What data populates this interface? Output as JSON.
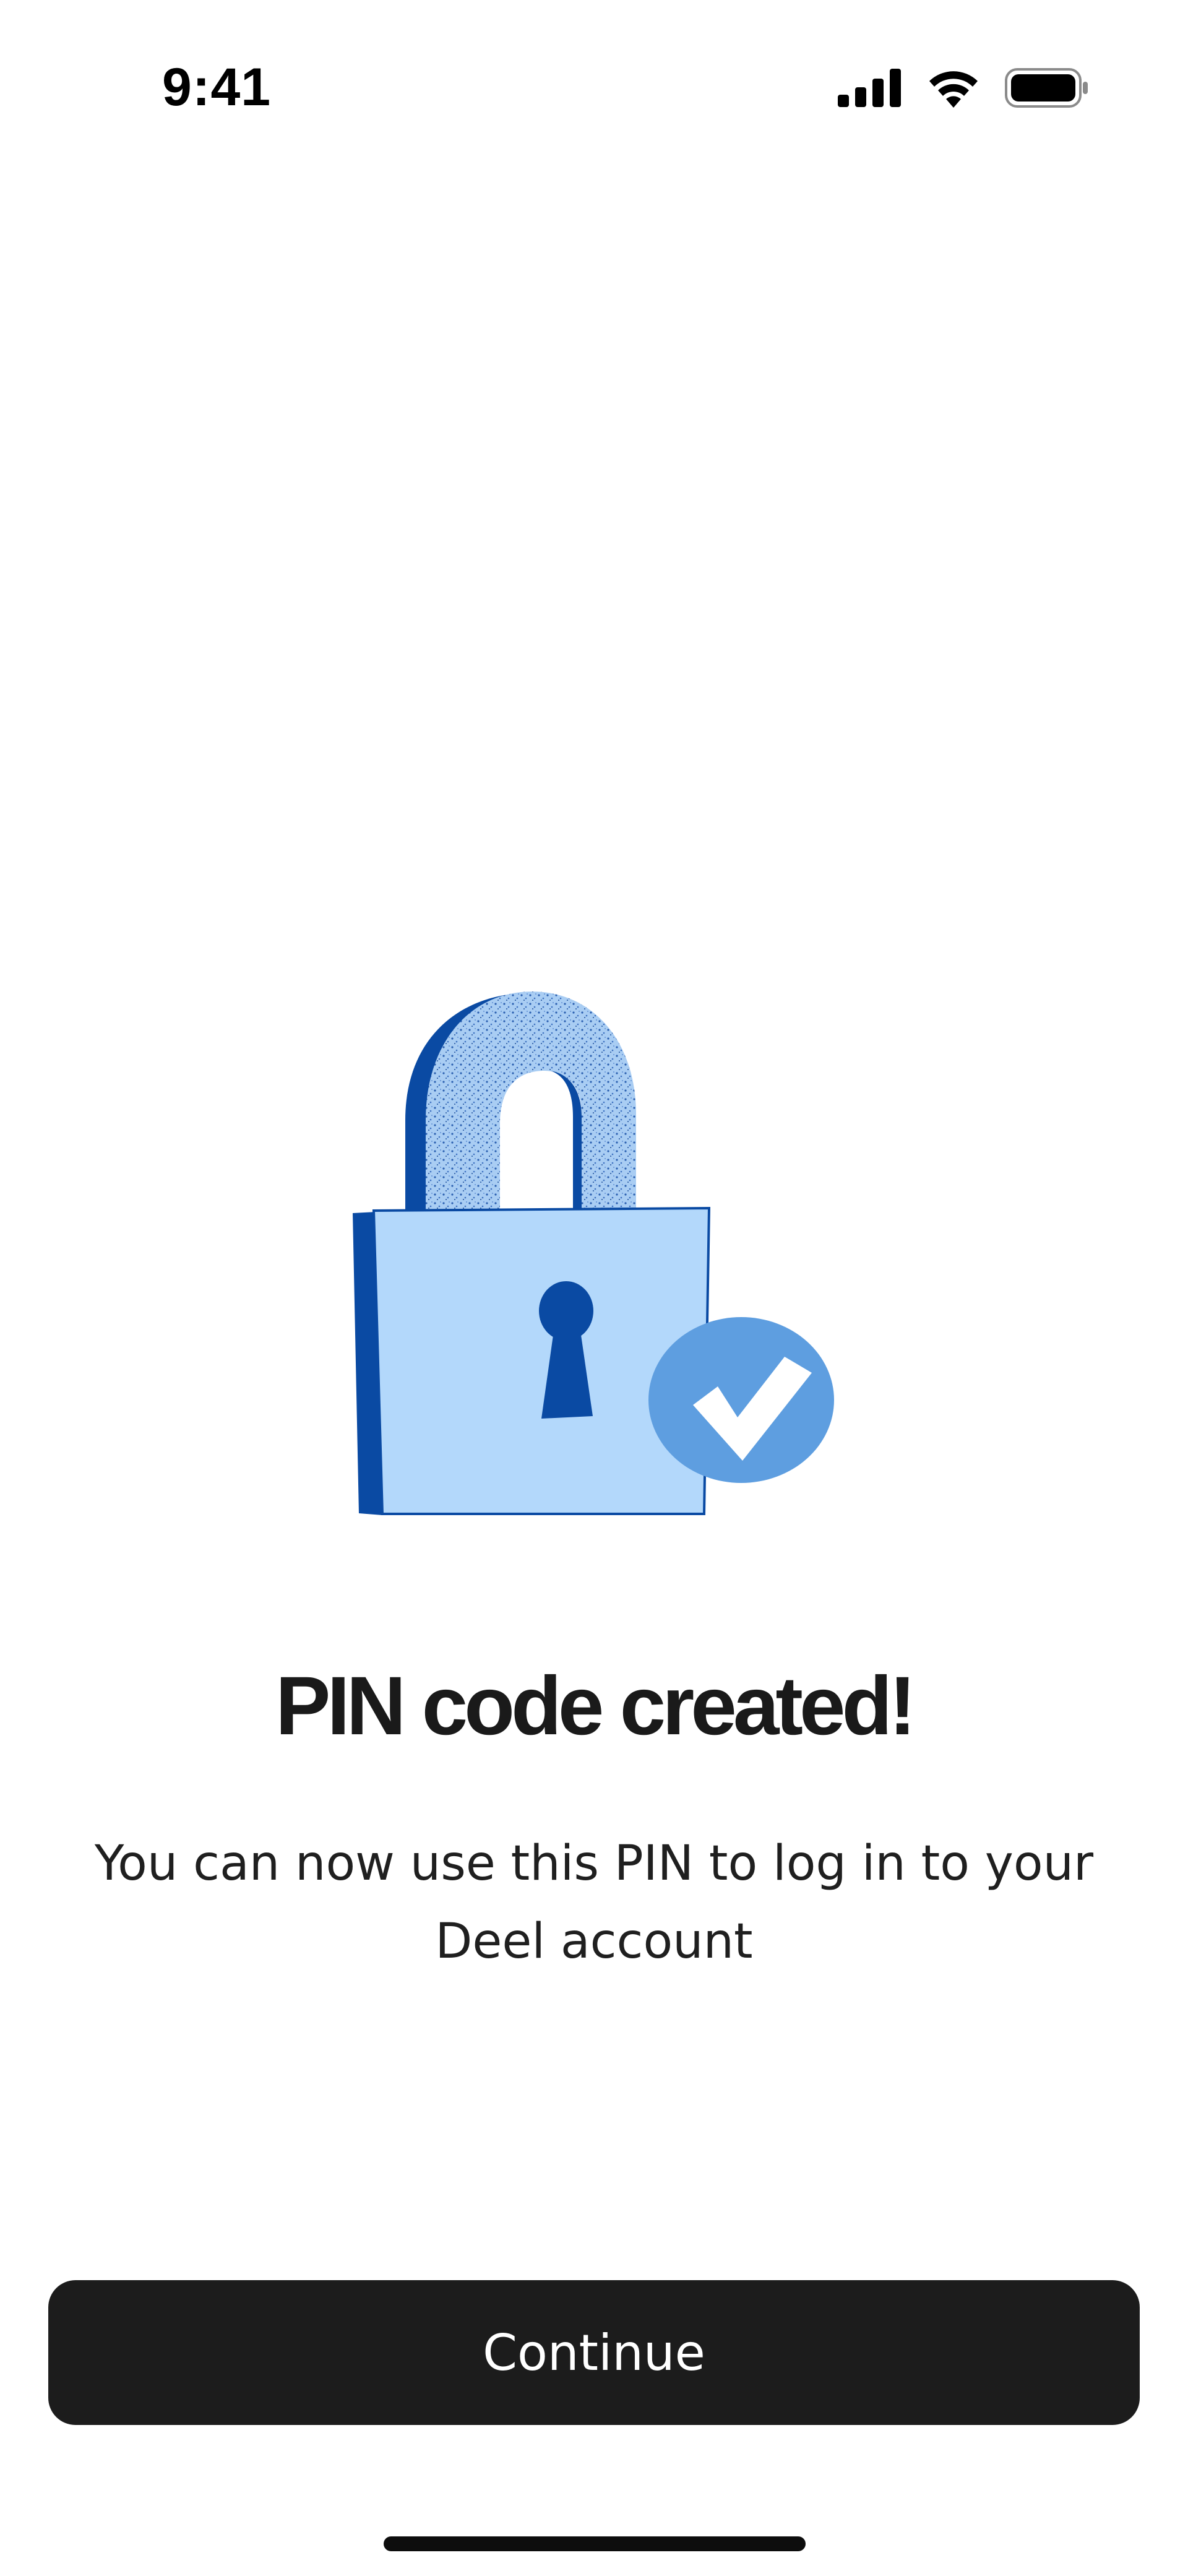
{
  "status_bar": {
    "time": "9:41",
    "icons": [
      "cellular-signal-icon",
      "wifi-icon",
      "battery-icon"
    ]
  },
  "illustration": {
    "icon": "padlock-check-icon",
    "colors": {
      "lock_body": "#b3d8fb",
      "lock_side": "#0a4aa3",
      "check_circle": "#5e9ee0",
      "keyhole": "#0a4aa3"
    }
  },
  "content": {
    "title": "PIN code created!",
    "subtitle": "You can now use this PIN to log in to your Deel account"
  },
  "actions": {
    "continue_label": "Continue"
  },
  "theme": {
    "button_bg": "#1c1c1c",
    "button_text": "#ffffff",
    "background": "#ffffff"
  }
}
